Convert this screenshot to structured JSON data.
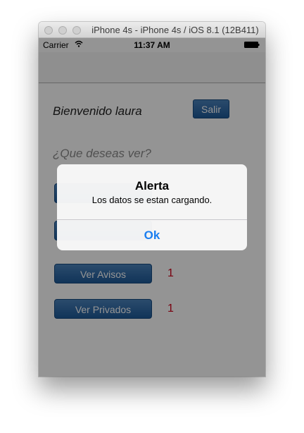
{
  "window": {
    "title": "iPhone 4s - iPhone 4s / iOS 8.1 (12B411)"
  },
  "status_bar": {
    "carrier": "Carrier",
    "time": "11:37 AM",
    "icons": [
      "wifi-icon",
      "battery-icon"
    ]
  },
  "main": {
    "welcome": "Bienvenido laura",
    "logout_label": "Salir",
    "question": "¿Que deseas ver?",
    "buttons": [
      {
        "label": ""
      },
      {
        "label": ""
      },
      {
        "label": "Ver Avisos",
        "count": "1"
      },
      {
        "label": "Ver Privados",
        "count": "1"
      }
    ]
  },
  "alert": {
    "title": "Alerta",
    "message": "Los datos se estan cargando.",
    "button": "Ok"
  },
  "colors": {
    "button_blue": "#1e5a99",
    "count_red": "#d0021b",
    "alert_action_blue": "#1a7ef0"
  }
}
